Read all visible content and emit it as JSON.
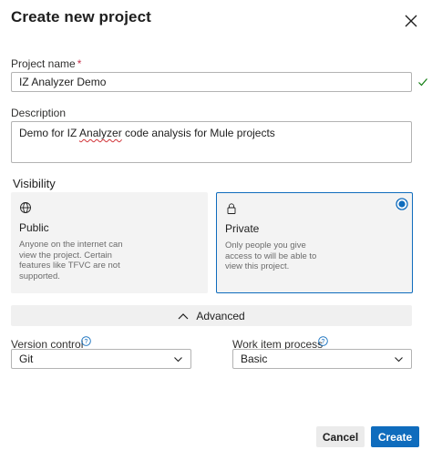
{
  "dialog": {
    "title": "Create new project"
  },
  "project_name": {
    "label": "Project name",
    "required_mark": "*",
    "value": "IZ Analyzer Demo"
  },
  "description": {
    "label": "Description",
    "value_before": "Demo for IZ ",
    "value_squiggle": "Analyzer",
    "value_after": " code analysis for Mule projects"
  },
  "visibility": {
    "label": "Visibility",
    "options": [
      {
        "title": "Public",
        "icon": "globe-icon",
        "description": "Anyone on the internet can view the project. Certain features like TFVC are not supported.",
        "selected": false
      },
      {
        "title": "Private",
        "icon": "lock-icon",
        "description": "Only people you give access to will be able to view this project.",
        "selected": true
      }
    ]
  },
  "advanced": {
    "label": "Advanced",
    "icon": "chevron-up-icon"
  },
  "version_control": {
    "label": "Version control",
    "value": "Git"
  },
  "work_item_process": {
    "label": "Work item process",
    "value": "Basic"
  },
  "buttons": {
    "cancel": "Cancel",
    "create": "Create"
  },
  "colors": {
    "accent": "#0f6cbd",
    "valid_check": "#107c10",
    "required": "#c4314b"
  }
}
